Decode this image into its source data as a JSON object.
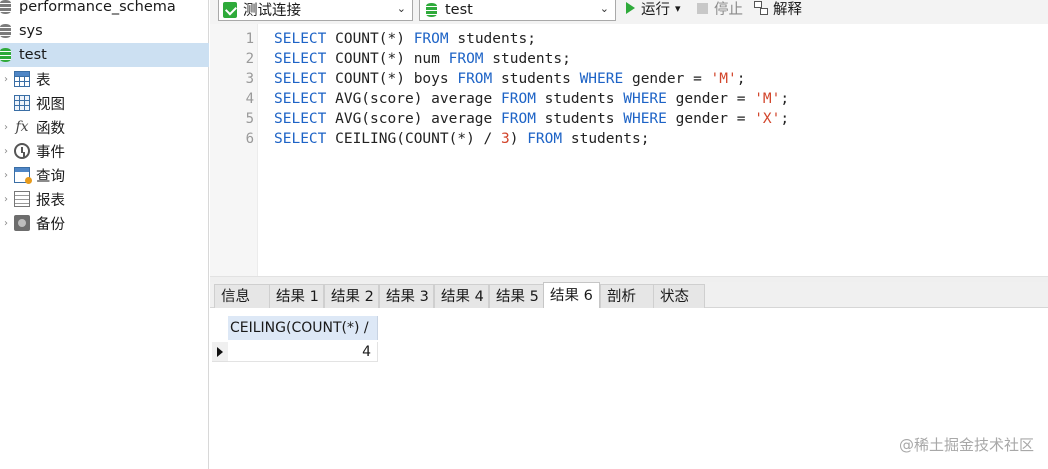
{
  "sidebar": {
    "databases": [
      {
        "name": "performance_schema",
        "selected": false,
        "color": "#7b7b7b"
      },
      {
        "name": "sys",
        "selected": false,
        "color": "#7b7b7b"
      },
      {
        "name": "test",
        "selected": true,
        "color": "#2eaa3a"
      }
    ],
    "objects": [
      {
        "label": "表",
        "icon": "table-icon"
      },
      {
        "label": "视图",
        "icon": "view-icon"
      },
      {
        "label": "函数",
        "icon": "function-icon"
      },
      {
        "label": "事件",
        "icon": "event-icon"
      },
      {
        "label": "查询",
        "icon": "query-icon"
      },
      {
        "label": "报表",
        "icon": "report-icon"
      },
      {
        "label": "备份",
        "icon": "backup-icon"
      }
    ]
  },
  "toolbar": {
    "connection": "测试连接",
    "database": "test",
    "run_label": "运行",
    "run_dropdown": "▾",
    "stop_label": "停止",
    "explain_label": "解释"
  },
  "editor": {
    "lines": [
      {
        "n": "1"
      },
      {
        "n": "2"
      },
      {
        "n": "3"
      },
      {
        "n": "4"
      },
      {
        "n": "5"
      },
      {
        "n": "6"
      }
    ],
    "code": {
      "l1": [
        "SELECT",
        " COUNT(*) ",
        "FROM",
        " students;"
      ],
      "l2": [
        "SELECT",
        " COUNT(*) num ",
        "FROM",
        " students;"
      ],
      "l3": [
        "SELECT",
        " COUNT(*) boys ",
        "FROM",
        " students ",
        "WHERE",
        " gender = ",
        "'M'",
        ";"
      ],
      "l4": [
        "SELECT",
        " AVG(score) average ",
        "FROM",
        " students ",
        "WHERE",
        " gender = ",
        "'M'",
        ";"
      ],
      "l5": [
        "SELECT",
        " AVG(score) average ",
        "FROM",
        " students ",
        "WHERE",
        " gender = ",
        "'X'",
        ";"
      ],
      "l6": [
        "SELECT",
        " CEILING(COUNT(*) / ",
        "3",
        ") ",
        "FROM",
        " students;"
      ]
    }
  },
  "tabs": [
    "信息",
    "结果 1",
    "结果 2",
    "结果 3",
    "结果 4",
    "结果 5",
    "结果 6",
    "剖析",
    "状态"
  ],
  "active_tab": "结果 6",
  "result": {
    "column": "CEILING(COUNT(*) /",
    "value": "4"
  },
  "watermark": "@稀土掘金技术社区",
  "colors": {
    "keyword": "#1d63c6",
    "string": "#d2452b",
    "selected_db": "#2eaa3a",
    "selection_bg": "#cce0f2"
  }
}
